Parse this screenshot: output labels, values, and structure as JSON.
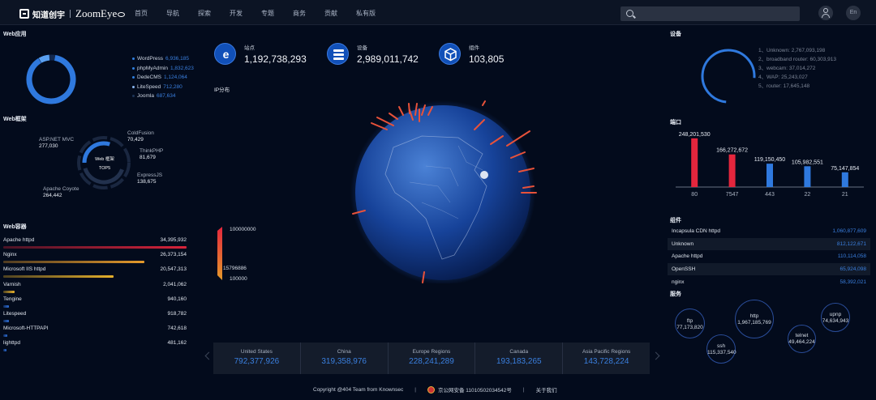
{
  "nav": {
    "logo_cn": "知道创宇",
    "logo_en": "ZoomEye",
    "links": [
      "首页",
      "导航",
      "探索",
      "开发",
      "专题",
      "商务",
      "贡献",
      "私有版"
    ],
    "search_placeholder": "",
    "lang": "En"
  },
  "web_apps": {
    "title": "Web应用",
    "items": [
      {
        "name": "WordPress",
        "value": "6,936,185"
      },
      {
        "name": "phpMyAdmin",
        "value": "1,832,623"
      },
      {
        "name": "DedeCMS",
        "value": "1,124,064"
      },
      {
        "name": "LiteSpeed",
        "value": "712,280"
      },
      {
        "name": "Joomla",
        "value": "687,634"
      }
    ]
  },
  "web_frameworks": {
    "title": "Web框架",
    "center_title": "Web 框架",
    "center_sub": "TOP5",
    "items": [
      {
        "name": "ASP.NET MVC",
        "value": "277,030"
      },
      {
        "name": "ColdFusion",
        "value": "70,429"
      },
      {
        "name": "ThinkPHP",
        "value": "81,679"
      },
      {
        "name": "ExpressJS",
        "value": "138,675"
      },
      {
        "name": "Apache Coyote",
        "value": "264,442"
      }
    ]
  },
  "web_containers": {
    "title": "Web容器",
    "items": [
      {
        "name": "Apache httpd",
        "value": "34,395,932",
        "ratio": 1.0,
        "color": "#d8233a"
      },
      {
        "name": "Nginx",
        "value": "26,373,154",
        "ratio": 0.77,
        "color": "#e59a2b"
      },
      {
        "name": "Microsoft IIS httpd",
        "value": "20,547,313",
        "ratio": 0.6,
        "color": "#e5b02b"
      },
      {
        "name": "Varnish",
        "value": "2,041,062",
        "ratio": 0.06,
        "color": "#e5b02b"
      },
      {
        "name": "Tengine",
        "value": "940,160",
        "ratio": 0.03,
        "color": "#2d6ed8"
      },
      {
        "name": "Litespeed",
        "value": "918,782",
        "ratio": 0.03,
        "color": "#2d6ed8"
      },
      {
        "name": "Microsoft-HTTPAPI",
        "value": "742,618",
        "ratio": 0.02,
        "color": "#2d6ed8"
      },
      {
        "name": "lighttpd",
        "value": "481,162",
        "ratio": 0.015,
        "color": "#2d6ed8"
      }
    ]
  },
  "stats": [
    {
      "label": "站点",
      "value": "1,192,738,293",
      "icon": "ie-icon"
    },
    {
      "label": "设备",
      "value": "2,989,011,742",
      "icon": "database-icon"
    },
    {
      "label": "组件",
      "value": "103,805",
      "icon": "cube-icon"
    }
  ],
  "ip_dist": {
    "title": "IP分布",
    "scale_top": "100000000",
    "scale_mid": "15796886",
    "scale_bottom": "100000"
  },
  "countries": [
    {
      "name": "United States",
      "value": "792,377,926"
    },
    {
      "name": "China",
      "value": "319,358,976"
    },
    {
      "name": "Europe Regions",
      "value": "228,241,289"
    },
    {
      "name": "Canada",
      "value": "193,183,265"
    },
    {
      "name": "Asia Pacific Regions",
      "value": "143,728,224"
    }
  ],
  "footer": {
    "copyright": "Copyright @404 Team from Knownsec",
    "police": "京公网安备 11010502034542号",
    "about": "关于我们",
    "sep": "|"
  },
  "devices": {
    "title": "设备",
    "items": [
      {
        "n": "1、",
        "text": "Unknown: 2,767,093,198"
      },
      {
        "n": "2、",
        "text": "broadband router: 60,303,913"
      },
      {
        "n": "3、",
        "text": "webcam: 37,014,272"
      },
      {
        "n": "4、",
        "text": "WAP: 25,243,027"
      },
      {
        "n": "5、",
        "text": "router: 17,645,148"
      }
    ]
  },
  "ports": {
    "title": "端口"
  },
  "chart_data": {
    "type": "bar",
    "categories": [
      "80",
      "7547",
      "443",
      "22",
      "21"
    ],
    "values": [
      248201530,
      166272672,
      119150450,
      105982551,
      75147854
    ],
    "labels": [
      "248,201,530",
      "166,272,672",
      "119,150,450",
      "105,982,551",
      "75,147,854"
    ],
    "colors": [
      "#e5263d",
      "#e5263d",
      "#2f79de",
      "#2f79de",
      "#2f79de"
    ],
    "ylim": [
      0,
      260000000
    ],
    "grid": false
  },
  "components": {
    "title": "组件",
    "items": [
      {
        "name": "Incapsula CDN httpd",
        "value": "1,060,877,609"
      },
      {
        "name": "Unknown",
        "value": "812,122,671"
      },
      {
        "name": "Apache httpd",
        "value": "110,114,058"
      },
      {
        "name": "OpenSSH",
        "value": "65,924,098"
      },
      {
        "name": "nginx",
        "value": "58,392,021"
      }
    ]
  },
  "services": {
    "title": "服务",
    "items": [
      {
        "name": "ftp",
        "value": "77,173,820"
      },
      {
        "name": "http",
        "value": "1,967,185,769"
      },
      {
        "name": "ssh",
        "value": "115,337,540"
      },
      {
        "name": "telnet",
        "value": "49,464,224"
      },
      {
        "name": "upnp",
        "value": "74,634,943"
      }
    ]
  }
}
